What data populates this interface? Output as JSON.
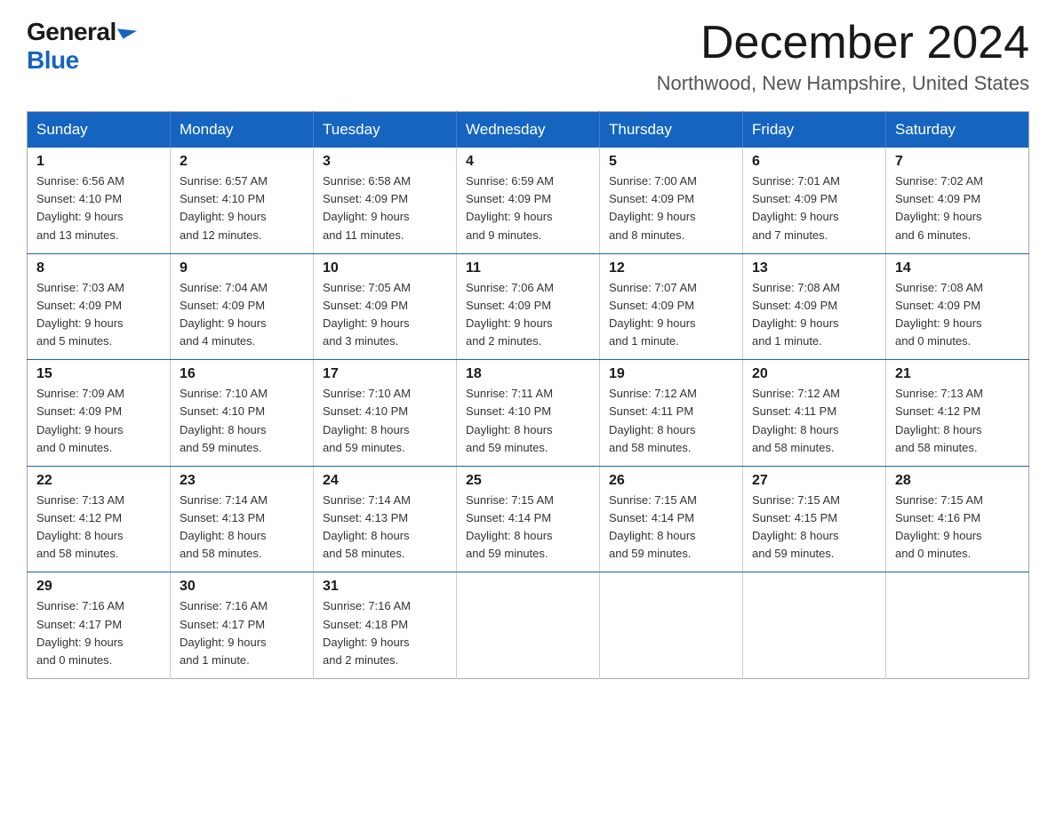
{
  "logo": {
    "general": "General",
    "blue": "Blue"
  },
  "title": "December 2024",
  "location": "Northwood, New Hampshire, United States",
  "days_of_week": [
    "Sunday",
    "Monday",
    "Tuesday",
    "Wednesday",
    "Thursday",
    "Friday",
    "Saturday"
  ],
  "weeks": [
    [
      {
        "day": "1",
        "sunrise": "6:56 AM",
        "sunset": "4:10 PM",
        "daylight": "9 hours and 13 minutes."
      },
      {
        "day": "2",
        "sunrise": "6:57 AM",
        "sunset": "4:10 PM",
        "daylight": "9 hours and 12 minutes."
      },
      {
        "day": "3",
        "sunrise": "6:58 AM",
        "sunset": "4:09 PM",
        "daylight": "9 hours and 11 minutes."
      },
      {
        "day": "4",
        "sunrise": "6:59 AM",
        "sunset": "4:09 PM",
        "daylight": "9 hours and 9 minutes."
      },
      {
        "day": "5",
        "sunrise": "7:00 AM",
        "sunset": "4:09 PM",
        "daylight": "9 hours and 8 minutes."
      },
      {
        "day": "6",
        "sunrise": "7:01 AM",
        "sunset": "4:09 PM",
        "daylight": "9 hours and 7 minutes."
      },
      {
        "day": "7",
        "sunrise": "7:02 AM",
        "sunset": "4:09 PM",
        "daylight": "9 hours and 6 minutes."
      }
    ],
    [
      {
        "day": "8",
        "sunrise": "7:03 AM",
        "sunset": "4:09 PM",
        "daylight": "9 hours and 5 minutes."
      },
      {
        "day": "9",
        "sunrise": "7:04 AM",
        "sunset": "4:09 PM",
        "daylight": "9 hours and 4 minutes."
      },
      {
        "day": "10",
        "sunrise": "7:05 AM",
        "sunset": "4:09 PM",
        "daylight": "9 hours and 3 minutes."
      },
      {
        "day": "11",
        "sunrise": "7:06 AM",
        "sunset": "4:09 PM",
        "daylight": "9 hours and 2 minutes."
      },
      {
        "day": "12",
        "sunrise": "7:07 AM",
        "sunset": "4:09 PM",
        "daylight": "9 hours and 1 minute."
      },
      {
        "day": "13",
        "sunrise": "7:08 AM",
        "sunset": "4:09 PM",
        "daylight": "9 hours and 1 minute."
      },
      {
        "day": "14",
        "sunrise": "7:08 AM",
        "sunset": "4:09 PM",
        "daylight": "9 hours and 0 minutes."
      }
    ],
    [
      {
        "day": "15",
        "sunrise": "7:09 AM",
        "sunset": "4:09 PM",
        "daylight": "9 hours and 0 minutes."
      },
      {
        "day": "16",
        "sunrise": "7:10 AM",
        "sunset": "4:10 PM",
        "daylight": "8 hours and 59 minutes."
      },
      {
        "day": "17",
        "sunrise": "7:10 AM",
        "sunset": "4:10 PM",
        "daylight": "8 hours and 59 minutes."
      },
      {
        "day": "18",
        "sunrise": "7:11 AM",
        "sunset": "4:10 PM",
        "daylight": "8 hours and 59 minutes."
      },
      {
        "day": "19",
        "sunrise": "7:12 AM",
        "sunset": "4:11 PM",
        "daylight": "8 hours and 58 minutes."
      },
      {
        "day": "20",
        "sunrise": "7:12 AM",
        "sunset": "4:11 PM",
        "daylight": "8 hours and 58 minutes."
      },
      {
        "day": "21",
        "sunrise": "7:13 AM",
        "sunset": "4:12 PM",
        "daylight": "8 hours and 58 minutes."
      }
    ],
    [
      {
        "day": "22",
        "sunrise": "7:13 AM",
        "sunset": "4:12 PM",
        "daylight": "8 hours and 58 minutes."
      },
      {
        "day": "23",
        "sunrise": "7:14 AM",
        "sunset": "4:13 PM",
        "daylight": "8 hours and 58 minutes."
      },
      {
        "day": "24",
        "sunrise": "7:14 AM",
        "sunset": "4:13 PM",
        "daylight": "8 hours and 58 minutes."
      },
      {
        "day": "25",
        "sunrise": "7:15 AM",
        "sunset": "4:14 PM",
        "daylight": "8 hours and 59 minutes."
      },
      {
        "day": "26",
        "sunrise": "7:15 AM",
        "sunset": "4:14 PM",
        "daylight": "8 hours and 59 minutes."
      },
      {
        "day": "27",
        "sunrise": "7:15 AM",
        "sunset": "4:15 PM",
        "daylight": "8 hours and 59 minutes."
      },
      {
        "day": "28",
        "sunrise": "7:15 AM",
        "sunset": "4:16 PM",
        "daylight": "9 hours and 0 minutes."
      }
    ],
    [
      {
        "day": "29",
        "sunrise": "7:16 AM",
        "sunset": "4:17 PM",
        "daylight": "9 hours and 0 minutes."
      },
      {
        "day": "30",
        "sunrise": "7:16 AM",
        "sunset": "4:17 PM",
        "daylight": "9 hours and 1 minute."
      },
      {
        "day": "31",
        "sunrise": "7:16 AM",
        "sunset": "4:18 PM",
        "daylight": "9 hours and 2 minutes."
      },
      null,
      null,
      null,
      null
    ]
  ],
  "labels": {
    "sunrise": "Sunrise:",
    "sunset": "Sunset:",
    "daylight": "Daylight:"
  }
}
